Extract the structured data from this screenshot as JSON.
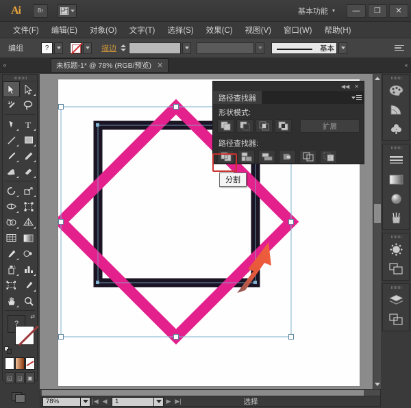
{
  "app": {
    "logo": "Ai",
    "bridge_label": "Br",
    "arrange_icon": "arrange-documents-icon",
    "workspace": "基本功能",
    "workspace_caret": "▾",
    "window_controls": [
      {
        "name": "minimize-button",
        "glyph": "—"
      },
      {
        "name": "maximize-button",
        "glyph": "❐"
      },
      {
        "name": "close-button",
        "glyph": "✕"
      }
    ]
  },
  "menubar": {
    "items": [
      "文件(F)",
      "编辑(E)",
      "对象(O)",
      "文字(T)",
      "选择(S)",
      "效果(C)",
      "视图(V)",
      "窗口(W)",
      "帮助(H)"
    ]
  },
  "controlbar": {
    "selection_label": "编组",
    "fill_swatch": "?",
    "stroke_swatch": "none",
    "stroke_label": "描边",
    "stroke_weight": "",
    "opacity_value": "",
    "stroke_profile": "基本",
    "panel_menu_icon": "panel-menu-icon"
  },
  "tabbar": {
    "collapse_left": "«",
    "collapse_right": "«",
    "document_tab": "未标题-1* @ 78% (RGB/预览)",
    "close_glyph": "✕"
  },
  "toolbar": {
    "tools": [
      {
        "name": "selection-tool",
        "icon": "arrow-solid",
        "selected": true
      },
      {
        "name": "direct-selection-tool",
        "icon": "arrow-outline",
        "selected": false
      },
      {
        "name": "magic-wand-tool",
        "icon": "magic-wand",
        "selected": false
      },
      {
        "name": "lasso-tool",
        "icon": "lasso",
        "selected": false
      },
      {
        "name": "pen-tool",
        "icon": "pen",
        "selected": false
      },
      {
        "name": "type-tool",
        "icon": "type-T",
        "selected": false
      },
      {
        "name": "line-segment-tool",
        "icon": "line",
        "selected": false
      },
      {
        "name": "rectangle-tool",
        "icon": "rectangle",
        "selected": false
      },
      {
        "name": "paintbrush-tool",
        "icon": "paintbrush",
        "selected": false
      },
      {
        "name": "pencil-tool",
        "icon": "pencil",
        "selected": false
      },
      {
        "name": "blob-brush-tool",
        "icon": "blob-brush",
        "selected": false
      },
      {
        "name": "eraser-tool",
        "icon": "eraser",
        "selected": false
      },
      {
        "name": "rotate-tool",
        "icon": "rotate",
        "selected": false
      },
      {
        "name": "scale-tool",
        "icon": "scale",
        "selected": false
      },
      {
        "name": "width-tool",
        "icon": "width",
        "selected": false
      },
      {
        "name": "free-transform-tool",
        "icon": "free-transform",
        "selected": false
      },
      {
        "name": "shape-builder-tool",
        "icon": "shape-builder",
        "selected": false
      },
      {
        "name": "perspective-grid-tool",
        "icon": "perspective-grid",
        "selected": false
      },
      {
        "name": "mesh-tool",
        "icon": "mesh",
        "selected": false
      },
      {
        "name": "gradient-tool",
        "icon": "gradient",
        "selected": false
      },
      {
        "name": "eyedropper-tool",
        "icon": "eyedropper",
        "selected": false
      },
      {
        "name": "blend-tool",
        "icon": "blend",
        "selected": false
      },
      {
        "name": "symbol-sprayer-tool",
        "icon": "symbol-sprayer",
        "selected": false
      },
      {
        "name": "column-graph-tool",
        "icon": "column-graph",
        "selected": false
      },
      {
        "name": "artboard-tool",
        "icon": "artboard",
        "selected": false
      },
      {
        "name": "slice-tool",
        "icon": "slice",
        "selected": false
      },
      {
        "name": "hand-tool",
        "icon": "hand",
        "selected": false
      },
      {
        "name": "zoom-tool",
        "icon": "magnifier",
        "selected": false
      }
    ],
    "fill_stroke": {
      "fill_name": "fill-swatch",
      "stroke_name": "stroke-swatch",
      "swap_glyph": "⇄",
      "default_name": "default-fill-stroke"
    },
    "color_modes": [
      {
        "name": "color-mode-button",
        "style": "white"
      },
      {
        "name": "gradient-mode-button",
        "style": "grad"
      },
      {
        "name": "none-mode-button",
        "style": "nonecol"
      }
    ],
    "screen_modes": [
      {
        "name": "normal-screen-mode-button",
        "glyph": "◱"
      },
      {
        "name": "full-screen-menubar-button",
        "glyph": "◲"
      },
      {
        "name": "full-screen-mode-button",
        "glyph": "▣"
      }
    ],
    "change_screen_mode": "change-screen-mode-button"
  },
  "canvas": {
    "artboard_name": "artboard",
    "shapes": {
      "square_stroke_color": "#1a1424",
      "diamond_stroke_color": "#e3208c",
      "selection_color": "#6fa8c9"
    },
    "annotation_arrow_color": "#e8573a"
  },
  "pathfinder": {
    "title": "路径查找器",
    "collapse_glyph": "◀◀",
    "close_glyph": "✕",
    "shape_modes_label": "形状模式:",
    "shape_mode_buttons": [
      {
        "name": "unite-button",
        "icon": "unite"
      },
      {
        "name": "minus-front-button",
        "icon": "minus-front"
      },
      {
        "name": "intersect-button",
        "icon": "intersect"
      },
      {
        "name": "exclude-button",
        "icon": "exclude"
      }
    ],
    "expand_label": "扩展",
    "pathfinders_label": "路径查找器:",
    "pathfinder_buttons": [
      {
        "name": "divide-button",
        "icon": "divide",
        "highlighted": true
      },
      {
        "name": "trim-button",
        "icon": "trim",
        "highlighted": false
      },
      {
        "name": "merge-button",
        "icon": "merge",
        "highlighted": false
      },
      {
        "name": "crop-button",
        "icon": "crop",
        "highlighted": false
      },
      {
        "name": "outline-button",
        "icon": "outline",
        "highlighted": false
      },
      {
        "name": "minus-back-button",
        "icon": "minus-back",
        "highlighted": false
      }
    ],
    "tooltip": "分割"
  },
  "dock": {
    "groups": [
      {
        "name": "dock-group-color",
        "items": [
          {
            "name": "color-panel-icon",
            "icon": "palette"
          },
          {
            "name": "color-guide-panel-icon",
            "icon": "color-guide"
          },
          {
            "name": "symbols-panel-icon",
            "icon": "clover"
          }
        ]
      },
      {
        "name": "dock-group-appearance",
        "items": [
          {
            "name": "stroke-panel-icon",
            "icon": "stroke-lines"
          },
          {
            "name": "gradient-panel-icon",
            "icon": "gradient-square"
          },
          {
            "name": "transparency-panel-icon",
            "icon": "sphere"
          },
          {
            "name": "brushes-panel-icon",
            "icon": "brush-cup"
          }
        ]
      },
      {
        "name": "dock-group-effects",
        "items": [
          {
            "name": "appearance-panel-icon",
            "icon": "circle-dots"
          },
          {
            "name": "graphic-styles-panel-icon",
            "icon": "two-squares"
          }
        ]
      },
      {
        "name": "dock-group-layers",
        "items": [
          {
            "name": "layers-panel-icon",
            "icon": "layers"
          },
          {
            "name": "artboards-panel-icon",
            "icon": "artboards"
          }
        ]
      }
    ]
  },
  "statusbar": {
    "zoom": "78%",
    "page": "1",
    "status_text": "选择",
    "first_glyph": "|◀",
    "prev_glyph": "◀",
    "next_glyph": "▶",
    "last_glyph": "▶|"
  }
}
